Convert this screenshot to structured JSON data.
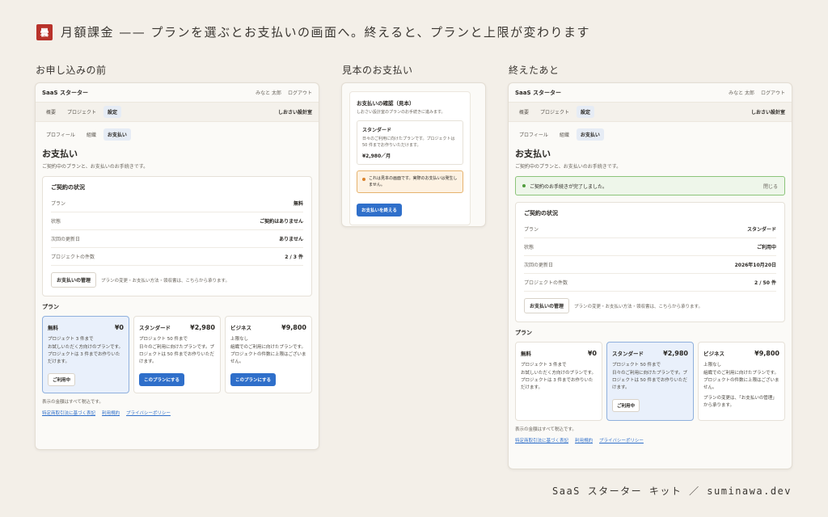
{
  "header": {
    "seal": "曇",
    "title": "月額課金 —— プランを選ぶとお支払いの画面へ。終えると、プランと上限が変わります"
  },
  "columns": {
    "before": "お申し込みの前",
    "mock": "見本のお支払い",
    "after": "終えたあと"
  },
  "app": {
    "brand": "SaaS スターター",
    "user": "みなと 太郎",
    "logout": "ログアウト",
    "nav": [
      "概要",
      "プロジェクト",
      "設定"
    ],
    "org": "しおさい設計室",
    "subtabs": [
      "プロフィール",
      "組織",
      "お支払い"
    ],
    "section_title": "お支払い",
    "section_desc": "ご契約中のプランと、お支払いのお手続きです。",
    "status_title": "ご契約の状況",
    "keys": {
      "plan": "プラン",
      "state": "状態",
      "renewal": "次回の更新日",
      "projects": "プロジェクトの件数"
    },
    "manage_button": "お支払いの管理",
    "manage_hint": "プランの変更・お支払い方法・領収書は、こちらから承ります。",
    "plans_title": "プラン",
    "plan_free": {
      "name": "無料",
      "price": "¥0",
      "limit": "プロジェクト 3 件まで",
      "desc": "お試しいただく方向けのプランです。プロジェクトは 3 件までお作りいただけます。"
    },
    "plan_standard": {
      "name": "スタンダード",
      "price": "¥2,980",
      "limit": "プロジェクト 50 件まで",
      "desc": "日々のご利用に向けたプランです。プロジェクトは 50 件までお作りいただけます。"
    },
    "plan_business": {
      "name": "ビジネス",
      "price": "¥9,800",
      "limit": "上限なし",
      "desc": "組織でのご利用に向けたプランです。プロジェクトの件数に上限はございません。",
      "change_note": "プランの変更は、「お支払いの管理」から承ります。"
    },
    "badge_current": "ご利用中",
    "choose_button": "このプランにする",
    "tax_note": "表示の金額はすべて税込です。",
    "links": [
      "特定商取引法に基づく表記",
      "利用規約",
      "プライバシーポリシー"
    ]
  },
  "before": {
    "plan": "無料",
    "state": "ご契約はありません",
    "renewal": "ありません",
    "projects": "2 / 3 件"
  },
  "after": {
    "notice": "ご契約のお手続きが完了しました。",
    "close": "閉じる",
    "plan": "スタンダード",
    "state": "ご利用中",
    "renewal": "2026年10月20日",
    "projects": "2 / 50 件"
  },
  "mock": {
    "title": "お支払いの確認（見本）",
    "desc": "しおさい設計室のプランのお手続きに進みます。",
    "plan_name": "スタンダード",
    "plan_desc": "日々のご利用に向けたプランです。プロジェクトは 50 件までお作りいただけます。",
    "plan_price": "¥2,980／月",
    "warning": "これは見本の画面です。実際のお支払いは発生しません。",
    "finish_button": "お支払いを終える"
  },
  "credit": "SaaS スターター キット ／ suminawa.dev",
  "colors": {
    "accent": "#2f6fca",
    "seal": "#b8322a",
    "success": "#4f9c3c",
    "warning": "#d9822b"
  }
}
